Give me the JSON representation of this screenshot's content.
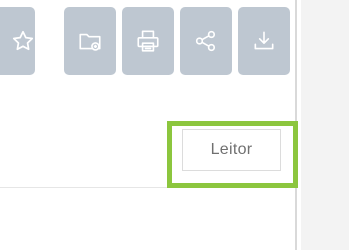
{
  "toolbar": {
    "buttons": [
      {
        "name": "favorite",
        "icon": "star-outline-icon"
      },
      {
        "name": "save-to-folder",
        "icon": "folder-plus-icon"
      },
      {
        "name": "print",
        "icon": "printer-icon"
      },
      {
        "name": "share",
        "icon": "share-icon"
      },
      {
        "name": "download",
        "icon": "download-icon"
      }
    ],
    "button_color": "#bec7d1",
    "icon_color": "#ffffff"
  },
  "reader_controls": {
    "translate_icon": "translate-icon",
    "font_size_icon": "font-size-icon",
    "reader_button_label": "Leitor",
    "highlight_color": "#8cc63e",
    "icon_color": "#9aa3ad"
  }
}
